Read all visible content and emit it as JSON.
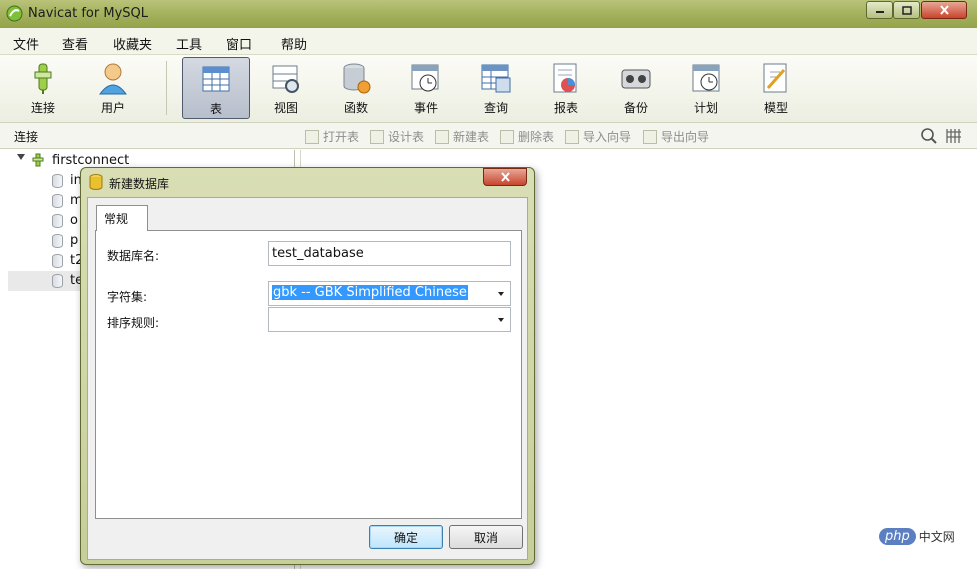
{
  "window": {
    "title": "Navicat for MySQL"
  },
  "menu": [
    "文件",
    "查看",
    "收藏夹",
    "工具",
    "窗口",
    "帮助"
  ],
  "toolbar": {
    "items": [
      {
        "label": "连接",
        "icon": "connection-icon"
      },
      {
        "label": "用户",
        "icon": "user-icon"
      },
      {
        "label": "表",
        "icon": "table-icon"
      },
      {
        "label": "视图",
        "icon": "view-icon"
      },
      {
        "label": "函数",
        "icon": "function-icon"
      },
      {
        "label": "事件",
        "icon": "event-icon"
      },
      {
        "label": "查询",
        "icon": "query-icon"
      },
      {
        "label": "报表",
        "icon": "report-icon"
      },
      {
        "label": "备份",
        "icon": "backup-icon"
      },
      {
        "label": "计划",
        "icon": "schedule-icon"
      },
      {
        "label": "模型",
        "icon": "model-icon"
      }
    ],
    "active": "表"
  },
  "objectbar": {
    "connection_label": "连接",
    "actions": [
      "打开表",
      "设计表",
      "新建表",
      "删除表",
      "导入向导",
      "导出向导"
    ]
  },
  "tree": {
    "root": "firstconnect",
    "databases": [
      "in",
      "m",
      "o",
      "p",
      "t2",
      "te"
    ],
    "selected": "te"
  },
  "dialog": {
    "title": "新建数据库",
    "tab": "常规",
    "db_name_label": "数据库名:",
    "db_name_value": "test_database",
    "charset_label": "字符集:",
    "charset_value": "gbk -- GBK Simplified Chinese",
    "collation_label": "排序规则:",
    "collation_value": "",
    "ok_label": "确定",
    "cancel_label": "取消"
  },
  "watermark": {
    "brand": "php",
    "site": "中文网"
  },
  "colors": {
    "titlebar": "#a6b35f",
    "selection": "#3399ff",
    "close": "#c8452d"
  }
}
